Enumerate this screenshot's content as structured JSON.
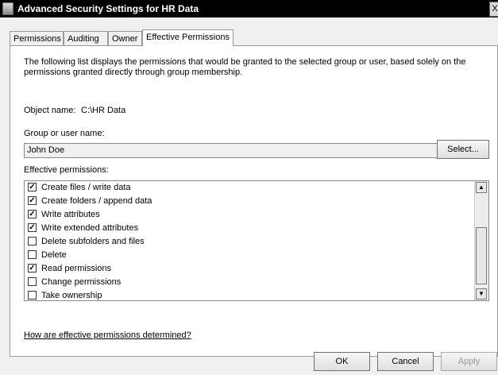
{
  "window": {
    "title": "Advanced Security Settings for HR Data",
    "close_glyph": "X"
  },
  "tabs": [
    {
      "label": "Permissions"
    },
    {
      "label": "Auditing"
    },
    {
      "label": "Owner"
    },
    {
      "label": "Effective Permissions",
      "active": true
    }
  ],
  "description": "The following list displays the permissions that would be granted to the selected group or user, based solely on the permissions granted directly through group membership.",
  "object": {
    "label": "Object name:",
    "value": "C:\\HR Data"
  },
  "group": {
    "label": "Group or user name:",
    "value": "John Doe",
    "select_label": "Select..."
  },
  "effective": {
    "label": "Effective permissions:",
    "items": [
      {
        "label": "Create files / write data",
        "checked": true,
        "mark": "✓"
      },
      {
        "label": "Create folders / append data",
        "checked": true,
        "mark": "✓"
      },
      {
        "label": "Write attributes",
        "checked": true,
        "mark": "✓"
      },
      {
        "label": "Write extended attributes",
        "checked": true,
        "mark": "✓"
      },
      {
        "label": "Delete subfolders and files",
        "checked": false,
        "mark": ""
      },
      {
        "label": "Delete",
        "checked": false,
        "mark": ""
      },
      {
        "label": "Read permissions",
        "checked": true,
        "mark": "✓"
      },
      {
        "label": "Change permissions",
        "checked": false,
        "mark": ""
      },
      {
        "label": "Take ownership",
        "checked": false,
        "mark": ""
      }
    ]
  },
  "help_link": "How are effective permissions determined?",
  "buttons": {
    "ok": "OK",
    "cancel": "Cancel",
    "apply": "Apply"
  }
}
